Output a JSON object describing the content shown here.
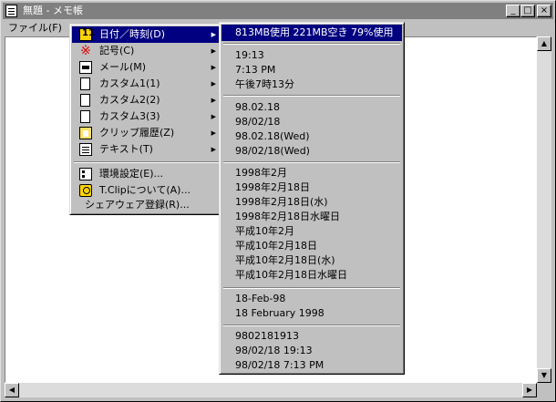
{
  "window": {
    "title": "無題 - メモ帳",
    "buttons": {
      "minimize": "_",
      "maximize": "□",
      "close": "×"
    }
  },
  "menubar": {
    "file": "ファイル(F)"
  },
  "context_menu": {
    "items": [
      {
        "label": "日付／時刻(D)",
        "icon": "calendar-icon",
        "submenu": true,
        "selected": true
      },
      {
        "label": "記号(C)",
        "icon": "asterisk-symbol-icon",
        "submenu": true
      },
      {
        "label": "メール(M)",
        "icon": "mail-icon",
        "submenu": true
      },
      {
        "label": "カスタム1(1)",
        "icon": "document-icon",
        "submenu": true
      },
      {
        "label": "カスタム2(2)",
        "icon": "document-icon",
        "submenu": true
      },
      {
        "label": "カスタム3(3)",
        "icon": "document-icon",
        "submenu": true
      },
      {
        "label": "クリップ履歴(Z)",
        "icon": "clipboard-icon",
        "submenu": true
      },
      {
        "label": "テキスト(T)",
        "icon": "text-grid-icon",
        "submenu": true
      },
      {
        "label": "環境設定(E)...",
        "icon": "settings-icon",
        "submenu": false
      },
      {
        "label": "T.Clipについて(A)...",
        "icon": "about-icon",
        "submenu": false
      },
      {
        "label": "シェアウェア登録(R)...",
        "icon": "",
        "submenu": false
      }
    ]
  },
  "submenu": {
    "groups": [
      [
        "813MB使用 221MB空き 79%使用"
      ],
      [
        "19:13",
        "7:13 PM",
        "午後7時13分"
      ],
      [
        "98.02.18",
        "98/02/18",
        "98.02.18(Wed)",
        "98/02/18(Wed)"
      ],
      [
        "1998年2月",
        "1998年2月18日",
        "1998年2月18日(水)",
        "1998年2月18日水曜日",
        "平成10年2月",
        "平成10年2月18日",
        "平成10年2月18日(水)",
        "平成10年2月18日水曜日"
      ],
      [
        "18-Feb-98",
        "18 February 1998"
      ],
      [
        "9802181913",
        "98/02/18 19:13",
        "98/02/18 7:13 PM"
      ]
    ]
  },
  "colors": {
    "highlight": "#000080",
    "face": "#c0c0c0",
    "titlebar_inactive": "#808080"
  }
}
